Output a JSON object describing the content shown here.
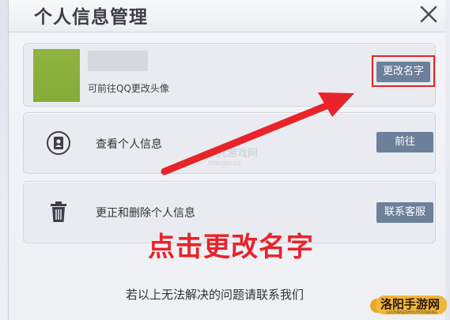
{
  "dialog": {
    "title": "个人信息管理"
  },
  "profile": {
    "subtext": "可前往QQ更改头像",
    "rename_label": "更改名字"
  },
  "rows": [
    {
      "label": "查看个人信息",
      "button_label": "前往",
      "icon": "id-card-icon"
    },
    {
      "label": "更正和删除个人信息",
      "button_label": "联系客服",
      "icon": "trash-icon"
    }
  ],
  "annotation": {
    "text": "点击更改名字",
    "color": "#e8232a"
  },
  "footer": {
    "text": "若以上无法解决的问题请联系我们"
  },
  "watermark": {
    "text": "小九游戏网",
    "sub": "xiaojiu.cc"
  },
  "logo": {
    "text": "洛阳手游网",
    "sub": "LUOYANGSHOUYOUWANG"
  },
  "colors": {
    "button": "#6d8099",
    "highlight": "#e02424",
    "avatar": "#8fb43f"
  }
}
